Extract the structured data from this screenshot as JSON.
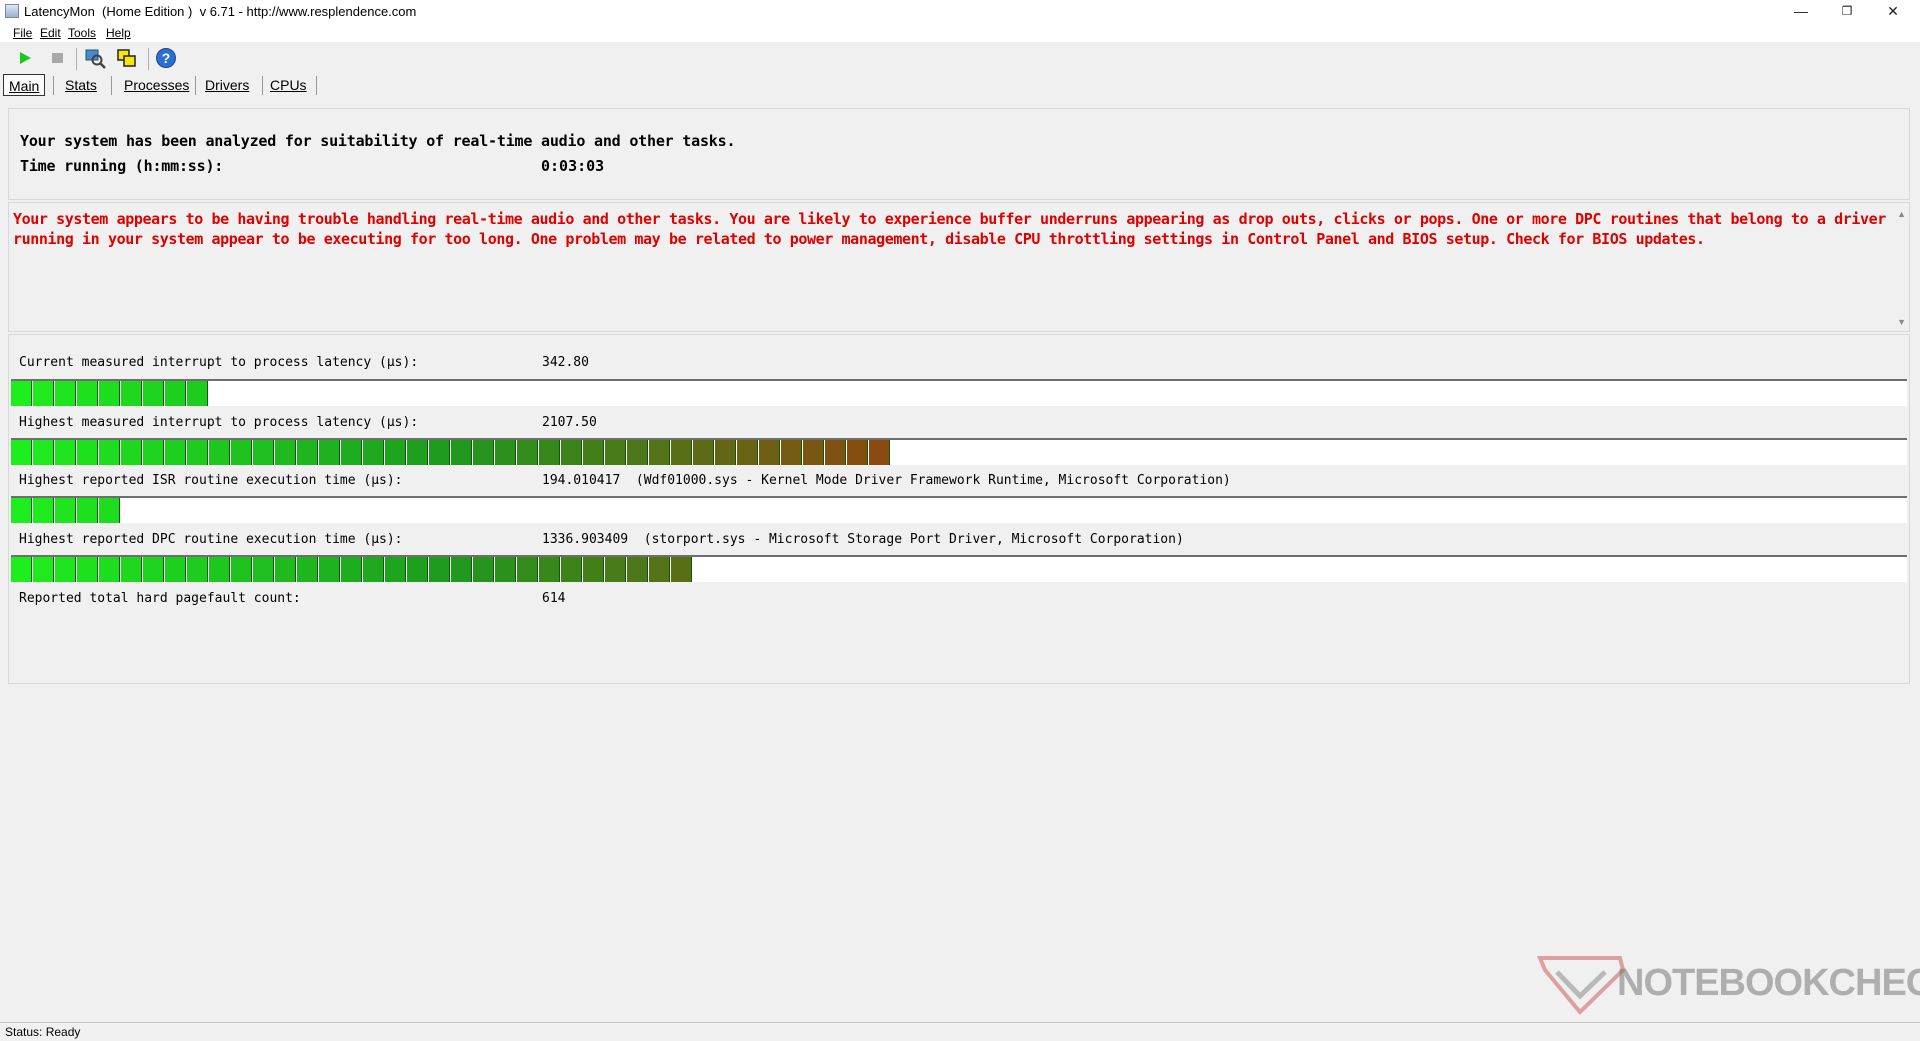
{
  "window": {
    "title": "LatencyMon  (Home Edition )  v 6.71 - http://www.resplendence.com",
    "minimize": "—",
    "restore": "❐",
    "close": "✕"
  },
  "menu": [
    "File",
    "Edit",
    "Tools",
    "Help"
  ],
  "toolbar": {
    "icons": [
      "play-icon",
      "stop-icon",
      "drivers-search-icon",
      "windows-icon",
      "help-icon"
    ],
    "help_glyph": "?"
  },
  "tabs": [
    "Main",
    "Stats",
    "Processes",
    "Drivers",
    "CPUs"
  ],
  "summary": {
    "line1": "Your system has been analyzed for suitability of real-time audio and other tasks.",
    "time_label": "Time running (h:mm:ss):",
    "time_value": "0:03:03"
  },
  "warning": {
    "text": "Your system appears to be having trouble handling real-time audio and other tasks. You are likely to experience buffer underruns appearing as drop outs, clicks or pops. One or more DPC routines that belong to a driver running in your system appear to be executing for too long. One problem may be related to power management, disable CPU throttling settings in Control Panel and BIOS setup. Check for BIOS updates.",
    "color": "#e00000"
  },
  "metrics": [
    {
      "label": "Current measured interrupt to process latency (µs):",
      "value": "342.80",
      "bar_segments": 9
    },
    {
      "label": "Highest measured interrupt to process latency (µs):",
      "value": "2107.50",
      "bar_segments": 40
    },
    {
      "label": "Highest reported ISR routine execution time (µs):",
      "value": "194.010417  (Wdf01000.sys - Kernel Mode Driver Framework Runtime, Microsoft Corporation)",
      "bar_segments": 5
    },
    {
      "label": "Highest reported DPC routine execution time (µs):",
      "value": "1336.903409  (storport.sys - Microsoft Storage Port Driver, Microsoft Corporation)",
      "bar_segments": 31
    },
    {
      "label": "Reported total hard pagefault count:",
      "value": "614"
    }
  ],
  "bar_colors": {
    "start": "#1eee1e",
    "mid": "#1e9a1e",
    "end": "#8a4a10"
  },
  "status": {
    "text": "Status: Ready"
  },
  "watermark": {
    "text": "NOTEBOOKCHECK"
  }
}
